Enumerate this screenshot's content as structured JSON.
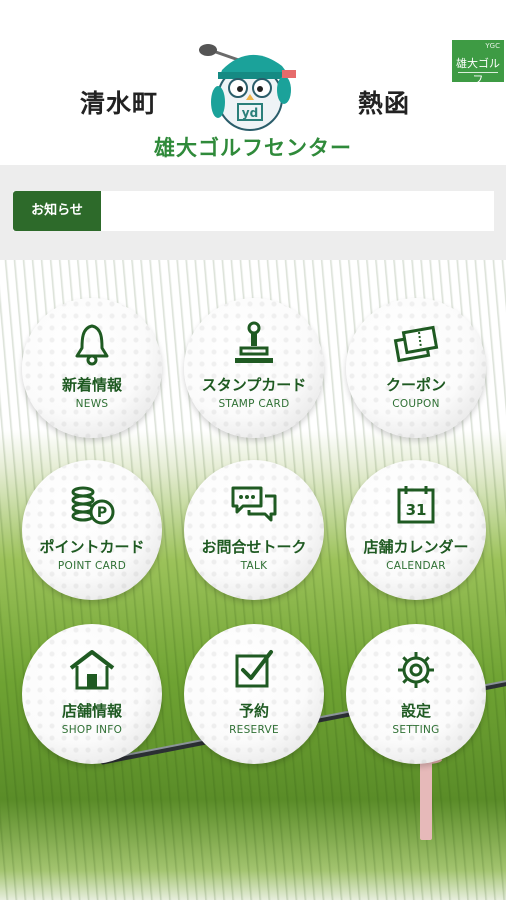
{
  "header": {
    "town_left": "清水町",
    "town_right": "熱函",
    "brand": "雄大ゴルフセンター",
    "flag_small": "YGC",
    "flag_name": "雄大ゴルフ"
  },
  "notice": {
    "label": "お知らせ",
    "text": ""
  },
  "menu": [
    {
      "jp": "新着情報",
      "en": "NEWS",
      "icon": "bell-icon"
    },
    {
      "jp": "スタンプカード",
      "en": "STAMP CARD",
      "icon": "stamp-icon"
    },
    {
      "jp": "クーポン",
      "en": "COUPON",
      "icon": "coupon-tickets-icon"
    },
    {
      "jp": "ポイントカード",
      "en": "POINT CARD",
      "icon": "coins-point-icon"
    },
    {
      "jp": "お問合せトーク",
      "en": "TALK",
      "icon": "chat-bubbles-icon"
    },
    {
      "jp": "店舗カレンダー",
      "en": "CALENDAR",
      "icon": "calendar-icon",
      "calendar_day": "31"
    },
    {
      "jp": "店舗情報",
      "en": "SHOP INFO",
      "icon": "house-icon"
    },
    {
      "jp": "予約",
      "en": "RESERVE",
      "icon": "checkbox-icon"
    },
    {
      "jp": "設定",
      "en": "SETTING",
      "icon": "gear-icon"
    }
  ],
  "colors": {
    "accent_green": "#2d6a2a",
    "brand_green": "#2f8a3a",
    "notice_band": "#ededed"
  }
}
